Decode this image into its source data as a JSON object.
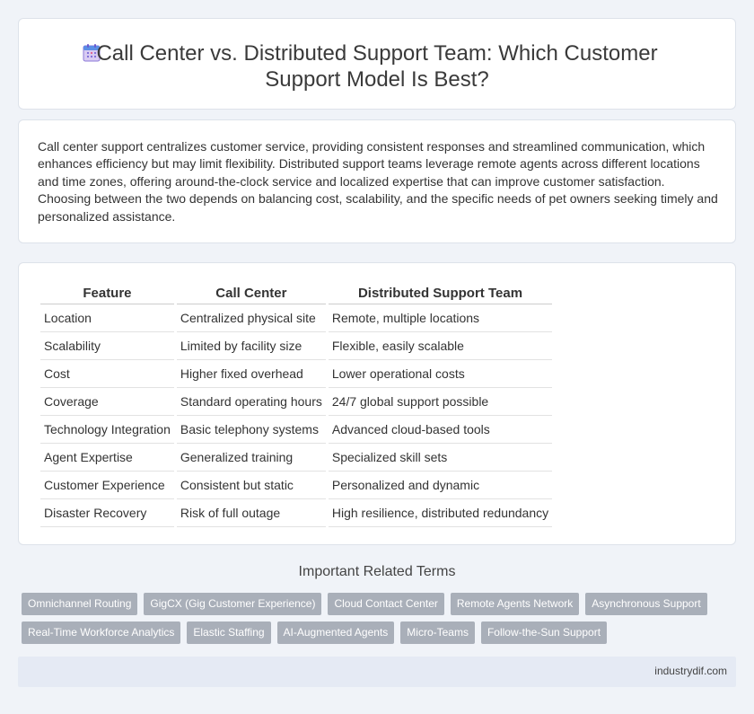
{
  "header": {
    "title": "Call Center vs. Distributed Support Team: Which Customer Support Model Is Best?",
    "icon": "calendar-icon"
  },
  "intro": {
    "text": "Call center support centralizes customer service, providing consistent responses and streamlined communication, which enhances efficiency but may limit flexibility. Distributed support teams leverage remote agents across different locations and time zones, offering around-the-clock service and localized expertise that can improve customer satisfaction. Choosing between the two depends on balancing cost, scalability, and the specific needs of pet owners seeking timely and personalized assistance."
  },
  "table": {
    "headers": [
      "Feature",
      "Call Center",
      "Distributed Support Team"
    ],
    "rows": [
      [
        "Location",
        "Centralized physical site",
        "Remote, multiple locations"
      ],
      [
        "Scalability",
        "Limited by facility size",
        "Flexible, easily scalable"
      ],
      [
        "Cost",
        "Higher fixed overhead",
        "Lower operational costs"
      ],
      [
        "Coverage",
        "Standard operating hours",
        "24/7 global support possible"
      ],
      [
        "Technology Integration",
        "Basic telephony systems",
        "Advanced cloud-based tools"
      ],
      [
        "Agent Expertise",
        "Generalized training",
        "Specialized skill sets"
      ],
      [
        "Customer Experience",
        "Consistent but static",
        "Personalized and dynamic"
      ],
      [
        "Disaster Recovery",
        "Risk of full outage",
        "High resilience, distributed redundancy"
      ]
    ]
  },
  "related": {
    "title": "Important Related Terms",
    "tags": [
      "Omnichannel Routing",
      "GigCX (Gig Customer Experience)",
      "Cloud Contact Center",
      "Remote Agents Network",
      "Asynchronous Support",
      "Real-Time Workforce Analytics",
      "Elastic Staffing",
      "AI-Augmented Agents",
      "Micro-Teams",
      "Follow-the-Sun Support"
    ]
  },
  "footer": {
    "site": "industrydif.com"
  },
  "colors": {
    "background": "#f0f3f8",
    "tag": "#a9afb9",
    "footer": "#e5eaf4"
  }
}
